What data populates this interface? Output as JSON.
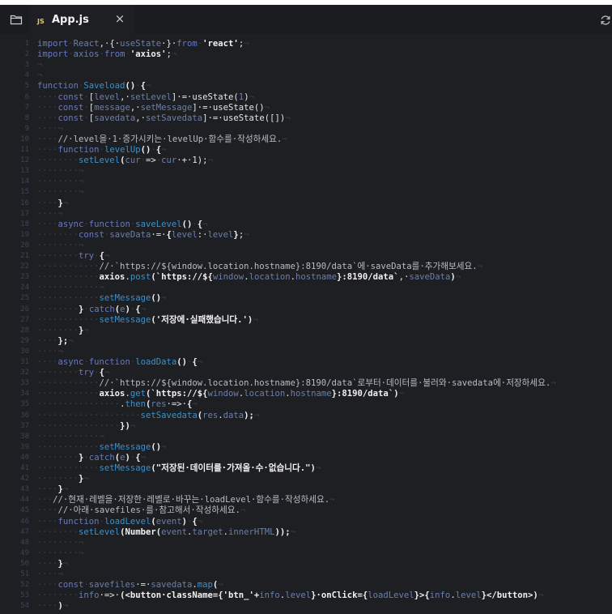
{
  "tab": {
    "badge": "JS",
    "title": "App.js",
    "close": "×"
  },
  "icons": {
    "folder": "folder-icon",
    "close": "close-icon",
    "refresh": "refresh-icon"
  },
  "colors": {
    "background": "#1e1f22",
    "tabbar": "#1b1c1f",
    "keyword": "#6779c6",
    "function": "#3c91c8",
    "identifier": "#6b7fa9",
    "whitespace_marker": "#3a3f4a",
    "line_number": "#3b4454"
  },
  "lines": [
    {
      "n": "1",
      "t": [
        [
          "kw",
          "import"
        ],
        [
          "ws",
          "·"
        ],
        [
          "vr",
          "React"
        ],
        [
          "pl",
          ",·{·"
        ],
        [
          "vr",
          "useState"
        ],
        [
          "pl",
          "·}·"
        ],
        [
          "kw",
          "from"
        ],
        [
          "ws",
          "·"
        ],
        [
          "str",
          "'react'"
        ],
        [
          "pl",
          ";"
        ],
        [
          "ws",
          "¬"
        ]
      ]
    },
    {
      "n": "2",
      "t": [
        [
          "kw",
          "import"
        ],
        [
          "ws",
          "·"
        ],
        [
          "vr",
          "axios"
        ],
        [
          "ws",
          "·"
        ],
        [
          "kw",
          "from"
        ],
        [
          "ws",
          "·"
        ],
        [
          "str",
          "'axios'"
        ],
        [
          "pl",
          ";"
        ],
        [
          "ws",
          "¬"
        ]
      ]
    },
    {
      "n": "3",
      "t": [
        [
          "ws",
          "¬"
        ]
      ]
    },
    {
      "n": "4",
      "t": [
        [
          "ws",
          "¬"
        ]
      ]
    },
    {
      "n": "5",
      "t": [
        [
          "kw",
          "function"
        ],
        [
          "ws",
          "·"
        ],
        [
          "fn",
          "Saveload"
        ],
        [
          "em",
          "()"
        ],
        [
          "ws",
          "·"
        ],
        [
          "em",
          "{"
        ],
        [
          "ws",
          "¬"
        ]
      ]
    },
    {
      "n": "6",
      "t": [
        [
          "ws",
          "····"
        ],
        [
          "kw",
          "const"
        ],
        [
          "ws",
          "·"
        ],
        [
          "pl",
          "["
        ],
        [
          "vr",
          "level"
        ],
        [
          "pl",
          ",·"
        ],
        [
          "vr",
          "setLevel"
        ],
        [
          "pl",
          "]·=·useState("
        ],
        [
          "vr",
          "1"
        ],
        [
          "pl",
          ")"
        ],
        [
          "ws",
          "¬"
        ]
      ]
    },
    {
      "n": "7",
      "t": [
        [
          "ws",
          "····"
        ],
        [
          "kw",
          "const"
        ],
        [
          "ws",
          "·"
        ],
        [
          "pl",
          "["
        ],
        [
          "vr",
          "message"
        ],
        [
          "pl",
          ",·"
        ],
        [
          "vr",
          "setMessage"
        ],
        [
          "pl",
          "]·=·useState()"
        ],
        [
          "ws",
          "¬"
        ]
      ]
    },
    {
      "n": "8",
      "t": [
        [
          "ws",
          "····"
        ],
        [
          "kw",
          "const"
        ],
        [
          "ws",
          "·"
        ],
        [
          "pl",
          "["
        ],
        [
          "vr",
          "savedata"
        ],
        [
          "pl",
          ",·"
        ],
        [
          "vr",
          "setSavedata"
        ],
        [
          "pl",
          "]·=·useState([])"
        ],
        [
          "ws",
          "¬"
        ]
      ]
    },
    {
      "n": "9",
      "t": [
        [
          "ws",
          "····¬"
        ]
      ]
    },
    {
      "n": "10",
      "t": [
        [
          "ws",
          "····"
        ],
        [
          "cm",
          "//·level을·1·증가시키는·levelUp·함수를·작성하세요."
        ],
        [
          "ws",
          "¬"
        ]
      ]
    },
    {
      "n": "11",
      "t": [
        [
          "ws",
          "····"
        ],
        [
          "kw",
          "function"
        ],
        [
          "ws",
          "·"
        ],
        [
          "fn",
          "levelUp"
        ],
        [
          "em",
          "()"
        ],
        [
          "ws",
          "·"
        ],
        [
          "em",
          "{"
        ],
        [
          "ws",
          "¬"
        ]
      ]
    },
    {
      "n": "12",
      "t": [
        [
          "ws",
          "········"
        ],
        [
          "fn",
          "setLevel"
        ],
        [
          "em",
          "("
        ],
        [
          "vr",
          "cur"
        ],
        [
          "ws",
          "·"
        ],
        [
          "pl",
          "=>"
        ],
        [
          "ws",
          "·"
        ],
        [
          "vr",
          "cur"
        ],
        [
          "pl",
          "·+·1);"
        ],
        [
          "ws",
          "¬"
        ]
      ]
    },
    {
      "n": "13",
      "t": [
        [
          "ws",
          "········¬"
        ]
      ]
    },
    {
      "n": "14",
      "t": [
        [
          "ws",
          "········¬"
        ]
      ]
    },
    {
      "n": "15",
      "t": [
        [
          "ws",
          "········¬"
        ]
      ]
    },
    {
      "n": "16",
      "t": [
        [
          "ws",
          "····"
        ],
        [
          "em",
          "}"
        ],
        [
          "ws",
          "¬"
        ]
      ]
    },
    {
      "n": "17",
      "t": [
        [
          "ws",
          "····¬"
        ]
      ]
    },
    {
      "n": "18",
      "t": [
        [
          "ws",
          "····"
        ],
        [
          "kw",
          "async"
        ],
        [
          "ws",
          "·"
        ],
        [
          "kw",
          "function"
        ],
        [
          "ws",
          "·"
        ],
        [
          "fn",
          "saveLevel"
        ],
        [
          "em",
          "()"
        ],
        [
          "ws",
          "·"
        ],
        [
          "em",
          "{"
        ],
        [
          "ws",
          "¬"
        ]
      ]
    },
    {
      "n": "19",
      "t": [
        [
          "ws",
          "········"
        ],
        [
          "kw",
          "const"
        ],
        [
          "ws",
          "·"
        ],
        [
          "vr",
          "saveData"
        ],
        [
          "pl",
          "·=·"
        ],
        [
          "em",
          "{"
        ],
        [
          "vr",
          "level"
        ],
        [
          "pl",
          ":·"
        ],
        [
          "vr",
          "level"
        ],
        [
          "em",
          "}"
        ],
        [
          "pl",
          ";"
        ],
        [
          "ws",
          "¬"
        ]
      ]
    },
    {
      "n": "20",
      "t": [
        [
          "ws",
          "········¬"
        ]
      ]
    },
    {
      "n": "21",
      "t": [
        [
          "ws",
          "········"
        ],
        [
          "kw",
          "try"
        ],
        [
          "ws",
          "·"
        ],
        [
          "em",
          "{"
        ],
        [
          "ws",
          "¬"
        ]
      ]
    },
    {
      "n": "22",
      "t": [
        [
          "ws",
          "············"
        ],
        [
          "cm",
          "//·`https://${window.location.hostname}:8190/data`에·saveData를·추가해보세요."
        ],
        [
          "ws",
          "¬"
        ]
      ]
    },
    {
      "n": "23",
      "t": [
        [
          "ws",
          "············"
        ],
        [
          "em",
          "axios"
        ],
        [
          "pl",
          "."
        ],
        [
          "fn",
          "post"
        ],
        [
          "em",
          "("
        ],
        [
          "str",
          "`https://${"
        ],
        [
          "vr",
          "window"
        ],
        [
          "pl",
          "."
        ],
        [
          "vr",
          "location"
        ],
        [
          "pl",
          "."
        ],
        [
          "vr",
          "hostname"
        ],
        [
          "str",
          "}:8190/data`"
        ],
        [
          "pl",
          ",·"
        ],
        [
          "vr",
          "saveData"
        ],
        [
          "em",
          ")"
        ],
        [
          "ws",
          "¬"
        ]
      ]
    },
    {
      "n": "24",
      "t": [
        [
          "ws",
          "············¬"
        ]
      ]
    },
    {
      "n": "25",
      "t": [
        [
          "ws",
          "············"
        ],
        [
          "fn",
          "setMessage"
        ],
        [
          "em",
          "()"
        ],
        [
          "ws",
          "¬"
        ]
      ]
    },
    {
      "n": "26",
      "t": [
        [
          "ws",
          "········"
        ],
        [
          "em",
          "}"
        ],
        [
          "ws",
          "·"
        ],
        [
          "kw",
          "catch"
        ],
        [
          "em",
          "("
        ],
        [
          "vr",
          "e"
        ],
        [
          "em",
          ")"
        ],
        [
          "ws",
          "·"
        ],
        [
          "em",
          "{"
        ],
        [
          "ws",
          "¬"
        ]
      ]
    },
    {
      "n": "27",
      "t": [
        [
          "ws",
          "············"
        ],
        [
          "fn",
          "setMessage"
        ],
        [
          "em",
          "('저장에·실패했습니다.')"
        ],
        [
          "ws",
          "¬"
        ]
      ]
    },
    {
      "n": "28",
      "t": [
        [
          "ws",
          "········"
        ],
        [
          "em",
          "}"
        ],
        [
          "ws",
          "¬"
        ]
      ]
    },
    {
      "n": "29",
      "t": [
        [
          "ws",
          "····"
        ],
        [
          "em",
          "};"
        ],
        [
          "ws",
          "¬"
        ]
      ]
    },
    {
      "n": "30",
      "t": [
        [
          "ws",
          "····¬"
        ]
      ]
    },
    {
      "n": "31",
      "t": [
        [
          "ws",
          "····"
        ],
        [
          "kw",
          "async"
        ],
        [
          "ws",
          "·"
        ],
        [
          "kw",
          "function"
        ],
        [
          "ws",
          "·"
        ],
        [
          "fn",
          "loadData"
        ],
        [
          "em",
          "()"
        ],
        [
          "ws",
          "·"
        ],
        [
          "em",
          "{"
        ],
        [
          "ws",
          "¬"
        ]
      ]
    },
    {
      "n": "32",
      "t": [
        [
          "ws",
          "········"
        ],
        [
          "kw",
          "try"
        ],
        [
          "ws",
          "·"
        ],
        [
          "em",
          "{"
        ],
        [
          "ws",
          "¬"
        ]
      ]
    },
    {
      "n": "33",
      "t": [
        [
          "ws",
          "············"
        ],
        [
          "cm",
          "//·`https://${window.location.hostname}:8190/data`로부터·데이터를·불러와·savedata에·저장하세요."
        ],
        [
          "ws",
          "¬"
        ]
      ]
    },
    {
      "n": "34",
      "t": [
        [
          "ws",
          "············"
        ],
        [
          "em",
          "axios"
        ],
        [
          "pl",
          "."
        ],
        [
          "fn",
          "get"
        ],
        [
          "em",
          "("
        ],
        [
          "str",
          "`https://${"
        ],
        [
          "vr",
          "window"
        ],
        [
          "pl",
          "."
        ],
        [
          "vr",
          "location"
        ],
        [
          "pl",
          "."
        ],
        [
          "vr",
          "hostname"
        ],
        [
          "str",
          "}:8190/data`"
        ],
        [
          "em",
          ")"
        ],
        [
          "ws",
          "¬"
        ]
      ]
    },
    {
      "n": "35",
      "t": [
        [
          "ws",
          "················"
        ],
        [
          "pl",
          "."
        ],
        [
          "fn",
          "then"
        ],
        [
          "em",
          "("
        ],
        [
          "vr",
          "res"
        ],
        [
          "pl",
          "·=>·"
        ],
        [
          "em",
          "{"
        ],
        [
          "ws",
          "¬"
        ]
      ]
    },
    {
      "n": "36",
      "t": [
        [
          "ws",
          "····················"
        ],
        [
          "fn",
          "setSavedata"
        ],
        [
          "em",
          "("
        ],
        [
          "vr",
          "res"
        ],
        [
          "pl",
          "."
        ],
        [
          "vr",
          "data"
        ],
        [
          "em",
          ");"
        ],
        [
          "ws",
          "¬"
        ]
      ]
    },
    {
      "n": "37",
      "t": [
        [
          "ws",
          "················"
        ],
        [
          "em",
          "})"
        ],
        [
          "ws",
          "¬"
        ]
      ]
    },
    {
      "n": "38",
      "t": [
        [
          "ws",
          "············¬"
        ]
      ]
    },
    {
      "n": "39",
      "t": [
        [
          "ws",
          "············"
        ],
        [
          "fn",
          "setMessage"
        ],
        [
          "em",
          "()"
        ],
        [
          "ws",
          "¬"
        ]
      ]
    },
    {
      "n": "40",
      "t": [
        [
          "ws",
          "········"
        ],
        [
          "em",
          "}"
        ],
        [
          "ws",
          "·"
        ],
        [
          "kw",
          "catch"
        ],
        [
          "em",
          "("
        ],
        [
          "vr",
          "e"
        ],
        [
          "em",
          ")"
        ],
        [
          "ws",
          "·"
        ],
        [
          "em",
          "{"
        ],
        [
          "ws",
          "¬"
        ]
      ]
    },
    {
      "n": "41",
      "t": [
        [
          "ws",
          "············"
        ],
        [
          "fn",
          "setMessage"
        ],
        [
          "em",
          "(\"저장된·데이터를·가져올·수·없습니다.\")"
        ],
        [
          "ws",
          "¬"
        ]
      ]
    },
    {
      "n": "42",
      "t": [
        [
          "ws",
          "········"
        ],
        [
          "em",
          "}"
        ],
        [
          "ws",
          "¬"
        ]
      ]
    },
    {
      "n": "43",
      "t": [
        [
          "ws",
          "····"
        ],
        [
          "em",
          "}"
        ],
        [
          "ws",
          "¬"
        ]
      ]
    },
    {
      "n": "44",
      "t": [
        [
          "ws",
          "···"
        ],
        [
          "cm",
          "//·현재·레벨을·저장한·레벨로·바꾸는·loadLevel·함수를·작성하세요."
        ],
        [
          "ws",
          "¬"
        ]
      ]
    },
    {
      "n": "45",
      "t": [
        [
          "ws",
          "····"
        ],
        [
          "cm",
          "//·아래·savefiles·를·참고해서·작성하세요."
        ],
        [
          "ws",
          "¬"
        ]
      ]
    },
    {
      "n": "46",
      "t": [
        [
          "ws",
          "····"
        ],
        [
          "kw",
          "function"
        ],
        [
          "ws",
          "·"
        ],
        [
          "fn",
          "loadLevel"
        ],
        [
          "em",
          "("
        ],
        [
          "vr",
          "event"
        ],
        [
          "em",
          ")"
        ],
        [
          "ws",
          "·"
        ],
        [
          "em",
          "{"
        ],
        [
          "ws",
          "¬"
        ]
      ]
    },
    {
      "n": "47",
      "t": [
        [
          "ws",
          "········"
        ],
        [
          "fn",
          "setLevel"
        ],
        [
          "em",
          "(Number("
        ],
        [
          "vr",
          "event"
        ],
        [
          "pl",
          "."
        ],
        [
          "vr",
          "target"
        ],
        [
          "pl",
          "."
        ],
        [
          "vr",
          "innerHTML"
        ],
        [
          "em",
          "));"
        ],
        [
          "ws",
          "¬"
        ]
      ]
    },
    {
      "n": "48",
      "t": [
        [
          "ws",
          "········¬"
        ]
      ]
    },
    {
      "n": "49",
      "t": [
        [
          "ws",
          "········¬"
        ]
      ]
    },
    {
      "n": "50",
      "t": [
        [
          "ws",
          "····"
        ],
        [
          "em",
          "}"
        ],
        [
          "ws",
          "¬"
        ]
      ]
    },
    {
      "n": "51",
      "t": [
        [
          "ws",
          "····¬"
        ]
      ]
    },
    {
      "n": "52",
      "t": [
        [
          "ws",
          "····"
        ],
        [
          "kw",
          "const"
        ],
        [
          "ws",
          "·"
        ],
        [
          "vr",
          "savefiles"
        ],
        [
          "pl",
          "·=·"
        ],
        [
          "vr",
          "savedata"
        ],
        [
          "pl",
          "."
        ],
        [
          "fn",
          "map"
        ],
        [
          "em",
          "("
        ],
        [
          "ws",
          "¬"
        ]
      ]
    },
    {
      "n": "53",
      "t": [
        [
          "ws",
          "········"
        ],
        [
          "vr",
          "info"
        ],
        [
          "pl",
          "·=>·"
        ],
        [
          "em",
          "(<button·className={'btn_'+"
        ],
        [
          "vr",
          "info"
        ],
        [
          "pl",
          "."
        ],
        [
          "vr",
          "level"
        ],
        [
          "em",
          "}·onClick={"
        ],
        [
          "vr",
          "loadLevel"
        ],
        [
          "em",
          "}>{"
        ],
        [
          "vr",
          "info"
        ],
        [
          "pl",
          "."
        ],
        [
          "vr",
          "level"
        ],
        [
          "em",
          "}</button>)"
        ],
        [
          "ws",
          "¬"
        ]
      ]
    },
    {
      "n": "54",
      "t": [
        [
          "ws",
          "····"
        ],
        [
          "em",
          ")"
        ],
        [
          "ws",
          "¬"
        ]
      ]
    }
  ]
}
